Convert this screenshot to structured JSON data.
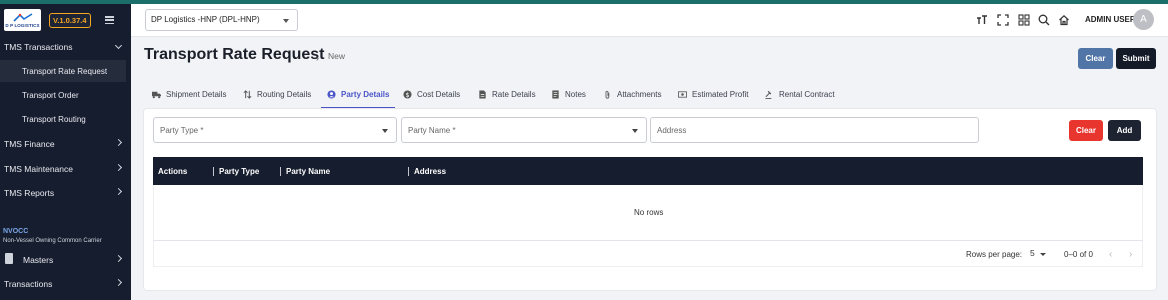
{
  "sidebar": {
    "logo_text": "D P LOGISTICS",
    "version": "V.1.0.37.4",
    "menu": {
      "tms_transactions": "TMS Transactions",
      "transport_rate_request": "Transport Rate Request",
      "transport_order": "Transport Order",
      "transport_routing": "Transport Routing",
      "tms_finance": "TMS Finance",
      "tms_maintenance": "TMS Maintenance",
      "tms_reports": "TMS Reports",
      "nvocc_title": "NVOCC",
      "nvocc_subtitle": "Non-Vessel Owning Common Carrier",
      "masters": "Masters",
      "transactions": "Transactions"
    }
  },
  "topbar": {
    "company": "DP Logistics -HNP  (DPL-HNP)",
    "user_name": "ADMIN USER",
    "avatar_initial": "A",
    "icons": [
      "text-size-icon",
      "fullscreen-icon",
      "apps-grid-icon",
      "search-icon",
      "home-icon"
    ]
  },
  "header": {
    "title": "Transport Rate Request",
    "breadcrumb_chevron": "›",
    "breadcrumb": "New",
    "clear_label": "Clear",
    "submit_label": "Submit"
  },
  "tabs": [
    {
      "label": "Shipment Details",
      "icon": "truck-icon"
    },
    {
      "label": "Routing Details",
      "icon": "route-icon"
    },
    {
      "label": "Party Details",
      "icon": "person-icon",
      "active": true
    },
    {
      "label": "Cost Details",
      "icon": "dollar-icon"
    },
    {
      "label": "Rate Details",
      "icon": "invoice-icon"
    },
    {
      "label": "Notes",
      "icon": "note-icon"
    },
    {
      "label": "Attachments",
      "icon": "paperclip-icon"
    },
    {
      "label": "Estimated Profit",
      "icon": "money-icon"
    },
    {
      "label": "Rental Contract",
      "icon": "gavel-icon"
    }
  ],
  "party_form": {
    "party_type_placeholder": "Party Type *",
    "party_name_placeholder": "Party Name *",
    "address_placeholder": "Address",
    "clear_label": "Clear",
    "add_label": "Add"
  },
  "grid": {
    "columns": [
      "Actions",
      "Party Type",
      "Party Name",
      "Address"
    ],
    "empty_text": "No rows",
    "rows_per_page_label": "Rows per page:",
    "rows_per_page": "5",
    "page_info": "0–0 of 0",
    "prev": "‹",
    "next": "›"
  },
  "colors": {
    "sidebar_bg": "#161d2e",
    "active_tab": "#4a55c8",
    "clear_top": "#5275a8",
    "danger": "#e8352e",
    "version_badge": "#f5a623"
  }
}
